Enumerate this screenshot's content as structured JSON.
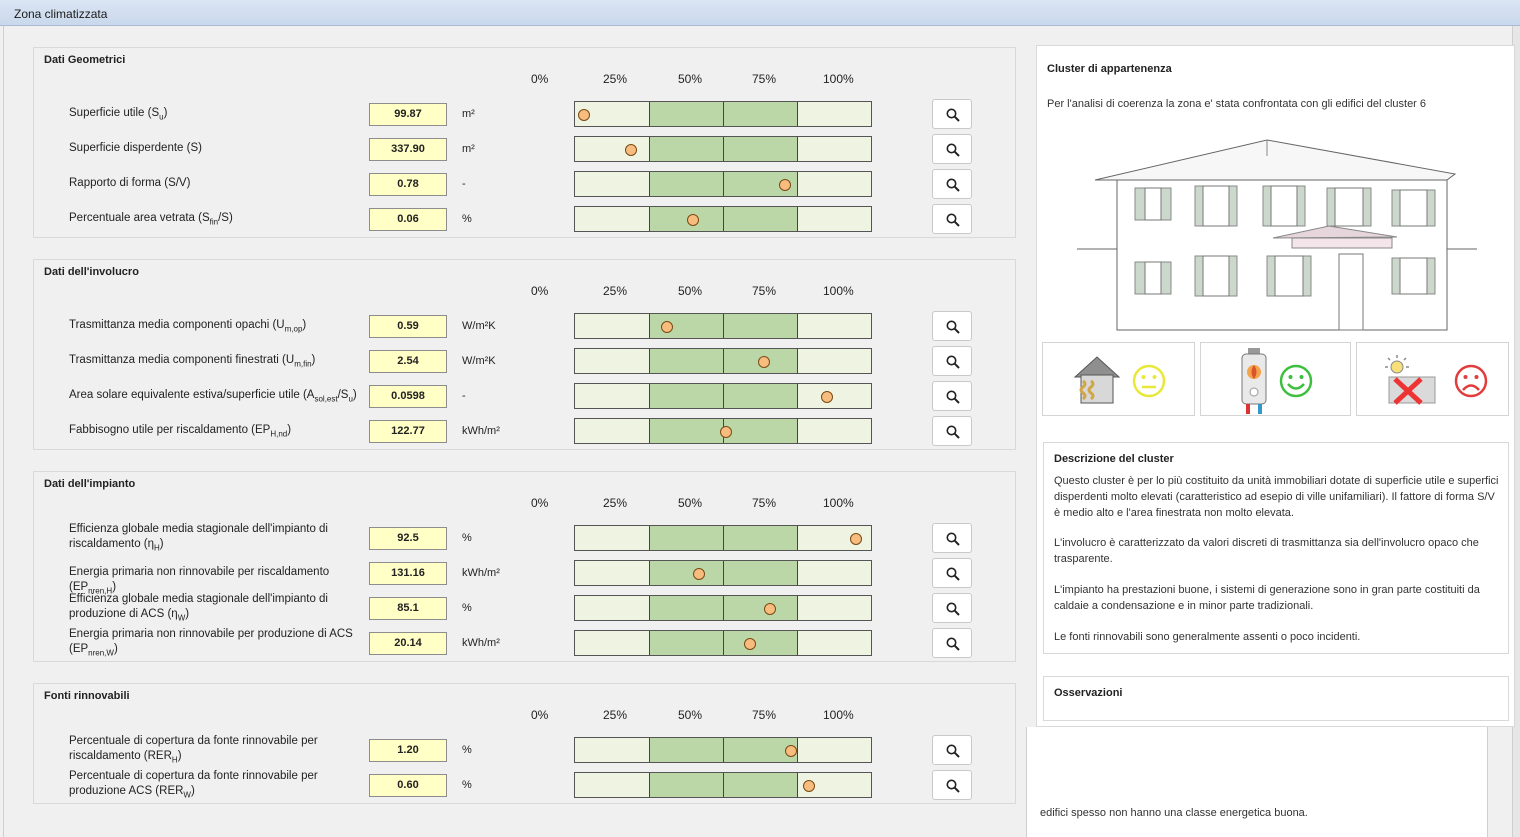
{
  "window": {
    "title": "Zona climatizzata"
  },
  "scale_labels": [
    "0%",
    "25%",
    "50%",
    "75%",
    "100%"
  ],
  "sections": [
    {
      "title": "Dati Geometrici",
      "rows": [
        {
          "label": "Superficie utile (S",
          "sub": "u",
          "suffix": ")",
          "value": "99.87",
          "unit": "m²",
          "position": 0.03
        },
        {
          "label": "Superficie disperdente (S)",
          "value": "337.90",
          "unit": "m²",
          "position": 0.19
        },
        {
          "label": "Rapporto di forma (S/V)",
          "value": "0.78",
          "unit": "-",
          "position": 0.71
        },
        {
          "label": "Percentuale area vetrata (S",
          "sub": "fin",
          "suffix": "/S)",
          "value": "0.06",
          "unit": "%",
          "position": 0.4
        }
      ]
    },
    {
      "title": "Dati dell'involucro",
      "rows": [
        {
          "label": "Trasmittanza media componenti opachi (U",
          "sub": "m,op",
          "suffix": ")",
          "value": "0.59",
          "unit": "W/m²K",
          "position": 0.31
        },
        {
          "label": "Trasmittanza media componenti finestrati (U",
          "sub": "m,fin",
          "suffix": ")",
          "value": "2.54",
          "unit": "W/m²K",
          "position": 0.64
        },
        {
          "label": "Area solare equivalente estiva/superficie utile (A",
          "sub": "sol,est",
          "suffix": "/S",
          "sub2": "u",
          "suffix2": ")",
          "value": "0.0598",
          "unit": "-",
          "position": 0.85
        },
        {
          "label": "Fabbisogno utile per riscaldamento (EP",
          "sub": "H,nd",
          "suffix": ")",
          "value": "122.77",
          "unit": "kWh/m²",
          "position": 0.51
        }
      ]
    },
    {
      "title": "Dati dell'impianto",
      "rows": [
        {
          "label": "Efficienza globale media stagionale dell'impianto di riscaldamento (η",
          "sub": "H",
          "suffix": ")",
          "value": "92.5",
          "unit": "%",
          "position": 0.95
        },
        {
          "label": "Energia primaria non rinnovabile per riscaldamento (EP",
          "sub": "nren,H",
          "suffix": ")",
          "value": "131.16",
          "unit": "kWh/m²",
          "position": 0.42
        },
        {
          "label": "Efficienza globale media stagionale dell'impianto di produzione di ACS (η",
          "sub": "W",
          "suffix": ")",
          "value": "85.1",
          "unit": "%",
          "position": 0.66
        },
        {
          "label": "Energia primaria non rinnovabile per produzione di ACS (EP",
          "sub": "nren,W",
          "suffix": ")",
          "value": "20.14",
          "unit": "kWh/m²",
          "position": 0.59
        }
      ]
    },
    {
      "title": "Fonti rinnovabili",
      "rows": [
        {
          "label": "Percentuale di copertura da fonte rinnovabile per riscaldamento (RER",
          "sub": "H",
          "suffix": ")",
          "value": "1.20",
          "unit": "%",
          "position": 0.73
        },
        {
          "label": "Percentuale di copertura da fonte rinnovabile per produzione ACS (RER",
          "sub": "W",
          "suffix": ")",
          "value": "0.60",
          "unit": "%",
          "position": 0.79
        }
      ]
    }
  ],
  "cluster": {
    "title": "Cluster di appartenenza",
    "intro": "Per l'analisi di coerenza la zona e' stata confrontata con gli edifici del cluster 6",
    "indicators": [
      {
        "icon": "house-insulation-icon",
        "mood": "neutral",
        "color": "#e8e83a"
      },
      {
        "icon": "boiler-icon",
        "mood": "happy",
        "color": "#3fbf3f"
      },
      {
        "icon": "solar-panel-crossed-icon",
        "mood": "sad",
        "color": "#e23c3c"
      }
    ],
    "description_title": "Descrizione del cluster",
    "description": [
      "Questo cluster è per lo più costituito da unità immobiliari dotate di superficie utile e superfici disperdenti molto elevati (caratteristico ad esepio di ville unifamiliari). Il fattore di forma S/V è medio alto e l'area finestrata non molto elevata.",
      "L'involucro è caratterizzato da valori discreti di trasmittanza sia dell'involucro opaco che trasparente.",
      "L'impianto ha prestazioni buone, i sistemi di generazione sono in gran parte costituiti da caldaie a condensazione e in minor parte tradizionali.",
      "Le fonti rinnovabili sono generalmente assenti o poco incidenti."
    ],
    "observations_title": "Osservazioni"
  },
  "under_panel": {
    "text": "edifici spesso non hanno una classe energetica buona."
  },
  "colors": {
    "value_bg": "#ffffc6",
    "bar_light": "#eef3e2",
    "bar_mid": "#bcd7a7",
    "dot": "#f8bd7e"
  }
}
